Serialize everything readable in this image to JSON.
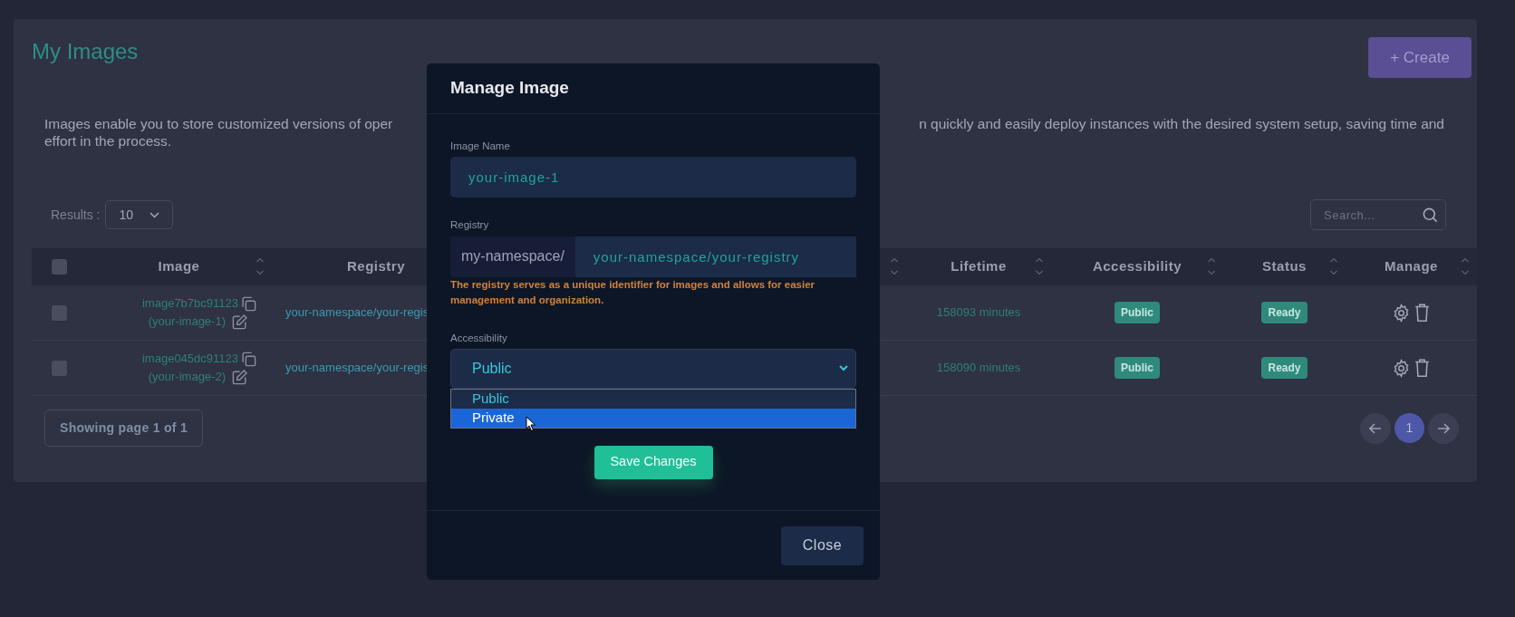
{
  "page": {
    "title": "My Images",
    "create_button": "+ Create"
  },
  "description": {
    "line_1_start": "Images enable you to store customized versions of oper",
    "line_1_end": "n quickly and easily deploy instances with the desired system setup, saving time and",
    "line_2": "effort in the process."
  },
  "results": {
    "label": "Results :",
    "value": "10"
  },
  "search": {
    "placeholder": "Search..."
  },
  "table": {
    "select_all_checked": false,
    "columns": [
      {
        "label": "Image",
        "sort_icon": true
      },
      {
        "label": "Registry",
        "sort_icon": false
      },
      {
        "sort_icon": true
      },
      {
        "label": "Lifetime",
        "sort_icon": true
      },
      {
        "label": "Accessibility",
        "sort_icon": true
      },
      {
        "label": "Status",
        "sort_icon": true
      },
      {
        "label": "Manage",
        "sort_icon": true
      }
    ],
    "rows": [
      {
        "checked": false,
        "image_id": "image7b7bc91123",
        "image_name": "(your-image-1)",
        "registry": "your-namespace/your-regis",
        "lifetime": "158093 minutes",
        "accessibility": "Public",
        "status": "Ready"
      },
      {
        "checked": false,
        "image_id": "image045dc91123",
        "image_name": "(your-image-2)",
        "registry": "your-namespace/your-regis",
        "lifetime": "158090 minutes",
        "accessibility": "Public",
        "status": "Ready"
      }
    ]
  },
  "pagination": {
    "summary": "Showing page 1 of 1",
    "pages": [
      {
        "label": "1",
        "selected": true
      }
    ]
  },
  "modal": {
    "title": "Manage Image",
    "image_name": {
      "label": "Image Name",
      "value": "your-image-1"
    },
    "registry": {
      "label": "Registry",
      "prefix": "my-namespace/",
      "value": "your-namespace/your-registry",
      "help": "The registry serves as a unique identifier for images and allows for easier management and organization."
    },
    "accessibility": {
      "label": "Accessibility",
      "value": "Public",
      "options": [
        {
          "label": "Public",
          "highlighted": false
        },
        {
          "label": "Private",
          "highlighted": true
        }
      ]
    },
    "save_button": "Save Changes",
    "close_button": "Close"
  }
}
